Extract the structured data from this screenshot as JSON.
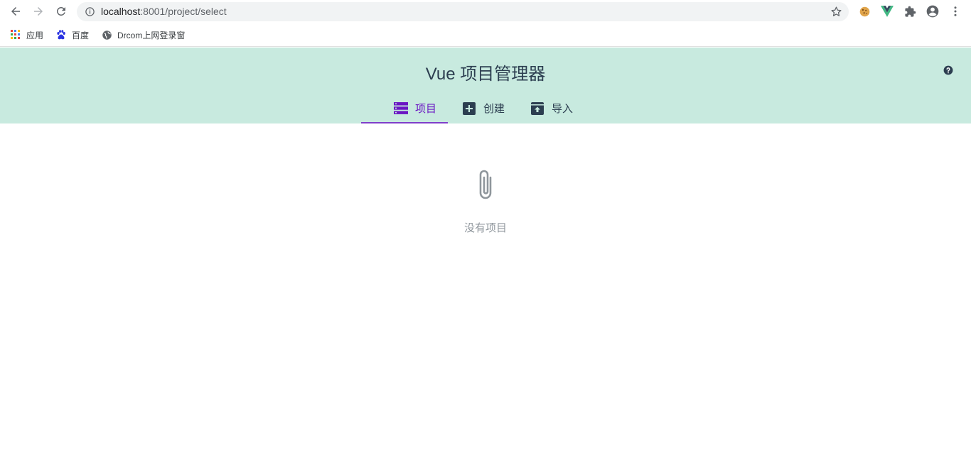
{
  "browser": {
    "url_host": "localhost",
    "url_path": ":8001/project/select",
    "bookmarks": [
      {
        "label": "应用",
        "icon": "apps-grid-icon"
      },
      {
        "label": "百度",
        "icon": "baidu-paw-icon"
      },
      {
        "label": "Drcom上网登录窗",
        "icon": "globe-icon"
      }
    ],
    "extensions": [
      "cookie-icon",
      "vue-devtools-icon",
      "puzzle-icon",
      "account-icon",
      "more-vert-icon"
    ]
  },
  "app": {
    "title": "Vue 项目管理器",
    "tabs": [
      {
        "label": "项目",
        "icon": "list-icon",
        "active": true
      },
      {
        "label": "创建",
        "icon": "plus-box-icon",
        "active": false
      },
      {
        "label": "导入",
        "icon": "import-icon",
        "active": false
      }
    ],
    "empty_message": "没有项目"
  },
  "colors": {
    "header_bg": "#c8eadf",
    "accent": "#6a16c3",
    "title": "#2c3e50",
    "muted": "#8f969c"
  }
}
